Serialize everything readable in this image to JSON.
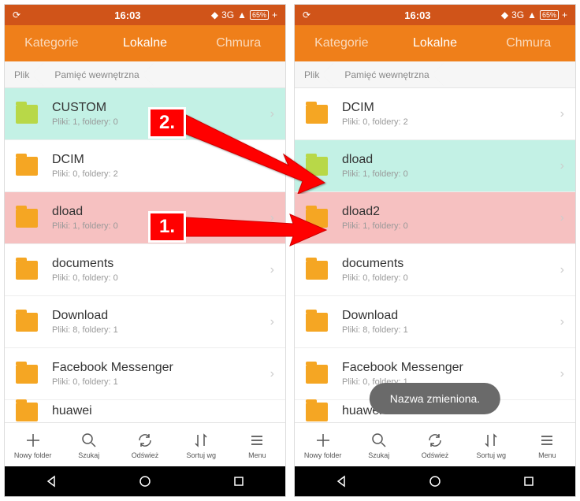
{
  "status": {
    "time": "16:03",
    "network": "3G",
    "battery": "65%"
  },
  "tabs": {
    "left": "Kategorie",
    "center": "Lokalne",
    "right": "Chmura"
  },
  "breadcrumb": {
    "root": "Plik",
    "path": "Pamięć wewnętrzna"
  },
  "left_folders": [
    {
      "name": "CUSTOM",
      "sub": "Pliki: 1, foldery: 0",
      "hl": "green",
      "iconGreen": true
    },
    {
      "name": "DCIM",
      "sub": "Pliki: 0, foldery: 2"
    },
    {
      "name": "dload",
      "sub": "Pliki: 1, foldery: 0",
      "hl": "pink"
    },
    {
      "name": "documents",
      "sub": "Pliki: 0, foldery: 0"
    },
    {
      "name": "Download",
      "sub": "Pliki: 8, foldery: 1"
    },
    {
      "name": "Facebook Messenger",
      "sub": "Pliki: 0, foldery: 1"
    },
    {
      "name": "huawei",
      "sub": ""
    }
  ],
  "right_folders": [
    {
      "name": "DCIM",
      "sub": "Pliki: 0, foldery: 2"
    },
    {
      "name": "dload",
      "sub": "Pliki: 1, foldery: 0",
      "hl": "green",
      "iconGreen": true
    },
    {
      "name": "dload2",
      "sub": "Pliki: 1, foldery: 0",
      "hl": "pink"
    },
    {
      "name": "documents",
      "sub": "Pliki: 0, foldery: 0"
    },
    {
      "name": "Download",
      "sub": "Pliki: 8, foldery: 1"
    },
    {
      "name": "Facebook Messenger",
      "sub": "Pliki: 0, foldery: 1"
    },
    {
      "name": "huawei",
      "sub": ""
    }
  ],
  "bottom": {
    "newfolder": "Nowy folder",
    "search": "Szukaj",
    "refresh": "Odśwież",
    "sort": "Sortuj wg",
    "menu": "Menu"
  },
  "toast": "Nazwa zmieniona.",
  "markers": {
    "one": "1.",
    "two": "2."
  }
}
